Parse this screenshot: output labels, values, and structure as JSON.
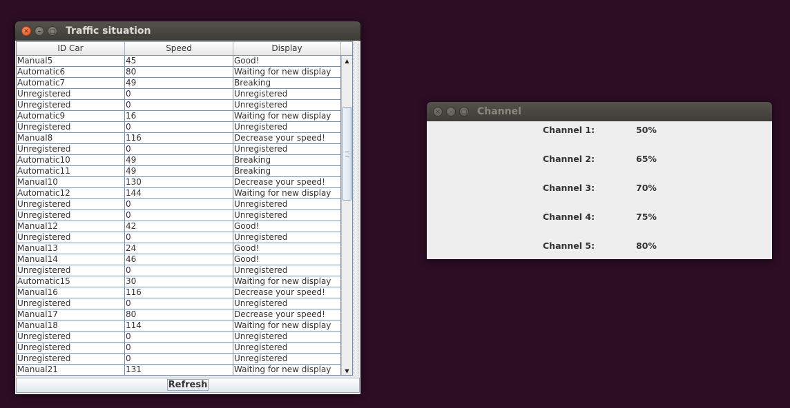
{
  "traffic_window": {
    "title": "Traffic situation",
    "columns": [
      "ID Car",
      "Speed",
      "Display"
    ],
    "rows": [
      [
        "Manual5",
        "45",
        "Good!"
      ],
      [
        "Automatic6",
        "80",
        "Waiting for new display"
      ],
      [
        "Automatic7",
        "49",
        "Breaking"
      ],
      [
        "Unregistered",
        "0",
        "Unregistered"
      ],
      [
        "Unregistered",
        "0",
        "Unregistered"
      ],
      [
        "Automatic9",
        "16",
        "Waiting for new display"
      ],
      [
        "Unregistered",
        "0",
        "Unregistered"
      ],
      [
        "Manual8",
        "116",
        "Decrease your speed!"
      ],
      [
        "Unregistered",
        "0",
        "Unregistered"
      ],
      [
        "Automatic10",
        "49",
        "Breaking"
      ],
      [
        "Automatic11",
        "49",
        "Breaking"
      ],
      [
        "Manual10",
        "130",
        "Decrease your speed!"
      ],
      [
        "Automatic12",
        "144",
        "Waiting for new display"
      ],
      [
        "Unregistered",
        "0",
        "Unregistered"
      ],
      [
        "Unregistered",
        "0",
        "Unregistered"
      ],
      [
        "Manual12",
        "42",
        "Good!"
      ],
      [
        "Unregistered",
        "0",
        "Unregistered"
      ],
      [
        "Manual13",
        "24",
        "Good!"
      ],
      [
        "Manual14",
        "46",
        "Good!"
      ],
      [
        "Unregistered",
        "0",
        "Unregistered"
      ],
      [
        "Automatic15",
        "30",
        "Waiting for new display"
      ],
      [
        "Manual16",
        "116",
        "Decrease your speed!"
      ],
      [
        "Unregistered",
        "0",
        "Unregistered"
      ],
      [
        "Manual17",
        "80",
        "Decrease your speed!"
      ],
      [
        "Manual18",
        "114",
        "Waiting for new display"
      ],
      [
        "Unregistered",
        "0",
        "Unregistered"
      ],
      [
        "Unregistered",
        "0",
        "Unregistered"
      ],
      [
        "Unregistered",
        "0",
        "Unregistered"
      ],
      [
        "Manual21",
        "131",
        "Waiting for new display"
      ]
    ],
    "refresh_label": "Refresh"
  },
  "channel_window": {
    "title": "Channel",
    "channels": [
      {
        "label": "Channel 1:",
        "value": "50%"
      },
      {
        "label": "Channel 2:",
        "value": "65%"
      },
      {
        "label": "Channel 3:",
        "value": "70%"
      },
      {
        "label": "Channel 4:",
        "value": "75%"
      },
      {
        "label": "Channel 5:",
        "value": "80%"
      }
    ]
  },
  "icons": {
    "close": "close-icon",
    "minimize": "minimize-icon",
    "maximize": "maximize-icon",
    "scroll_up": "scroll-up-arrow-icon",
    "scroll_down": "scroll-down-arrow-icon"
  },
  "colors": {
    "desktop": "#2c0d24",
    "close_button": "#e0551e",
    "window_bg": "#eeeeee"
  }
}
